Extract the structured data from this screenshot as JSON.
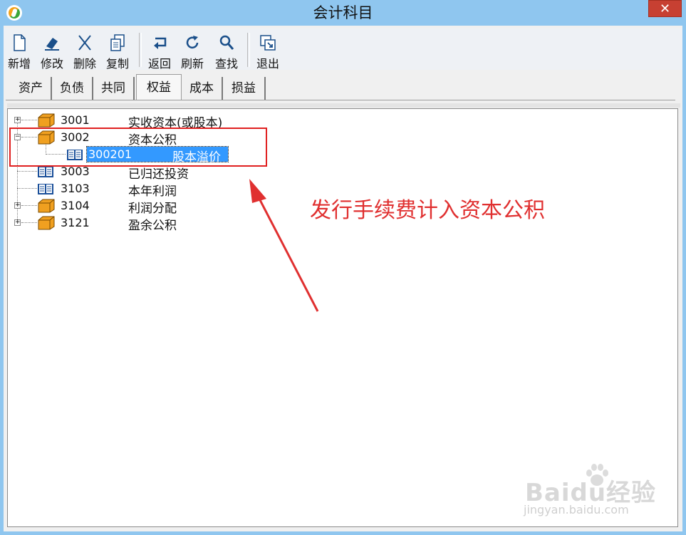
{
  "window": {
    "title": "会计科目",
    "close_label": "✕"
  },
  "toolbar": {
    "buttons": [
      {
        "label": "新增",
        "icon": "new-document-icon"
      },
      {
        "label": "修改",
        "icon": "eraser-icon"
      },
      {
        "label": "删除",
        "icon": "delete-x-icon"
      },
      {
        "label": "复制",
        "icon": "copy-icon"
      },
      {
        "label": "返回",
        "icon": "return-arrow-icon"
      },
      {
        "label": "刷新",
        "icon": "refresh-icon"
      },
      {
        "label": "查找",
        "icon": "search-icon"
      },
      {
        "label": "退出",
        "icon": "exit-icon"
      }
    ]
  },
  "tabs": [
    {
      "label": "资产",
      "active": false
    },
    {
      "label": "负债",
      "active": false
    },
    {
      "label": "共同",
      "active": false
    },
    {
      "label": "权益",
      "active": true
    },
    {
      "label": "成本",
      "active": false
    },
    {
      "label": "损益",
      "active": false
    }
  ],
  "tree": {
    "nodes": [
      {
        "code": "3001",
        "name": "实收资本(或股本)",
        "icon": "folder-box-icon",
        "expander": "+"
      },
      {
        "code": "3002",
        "name": "资本公积",
        "icon": "folder-box-icon",
        "expander": "−"
      },
      {
        "code": "300201",
        "name": "股本溢价",
        "icon": "book-icon",
        "selected": true
      },
      {
        "code": "3003",
        "name": "已归还投资",
        "icon": "book-icon"
      },
      {
        "code": "3103",
        "name": "本年利润",
        "icon": "book-icon"
      },
      {
        "code": "3104",
        "name": "利润分配",
        "icon": "folder-box-icon",
        "expander": "+"
      },
      {
        "code": "3121",
        "name": "盈余公积",
        "icon": "folder-box-icon",
        "expander": "+"
      }
    ]
  },
  "annotation": {
    "text": "发行手续费计入资本公积",
    "color": "#e03030"
  },
  "watermark": {
    "main": "Baidu经验",
    "sub": "jingyan.baidu.com"
  },
  "colors": {
    "titlebar": "#8fc6ef",
    "selection": "#3399ff",
    "close": "#c74032"
  }
}
